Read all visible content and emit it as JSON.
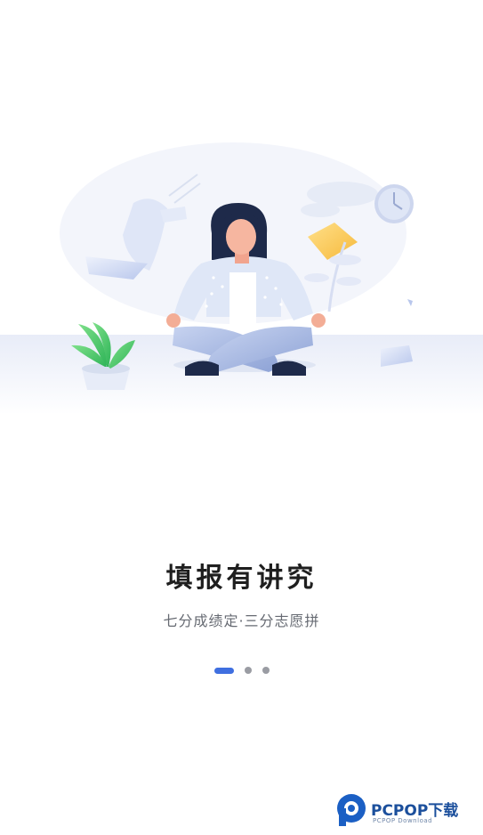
{
  "onboarding": {
    "title": "填报有讲究",
    "subtitle": "七分成绩定·三分志愿拼",
    "pager": {
      "count": 3,
      "active_index": 0
    }
  },
  "watermark": {
    "brand": "PCPOP下载",
    "tagline": "PCPOP Download"
  },
  "colors": {
    "accent": "#3f6fe0",
    "title_text": "#1f1f1f",
    "subtitle_text": "#666a72",
    "dot_inactive": "#9a9ca3"
  }
}
